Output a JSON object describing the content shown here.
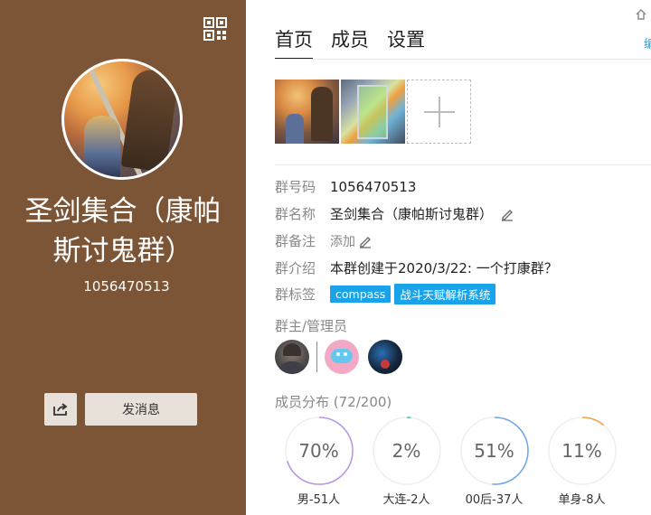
{
  "group": {
    "name": "圣剑集合（康帕斯讨鬼群）",
    "id": "1056470513"
  },
  "actions": {
    "send_message_label": "发消息"
  },
  "tabs": [
    {
      "label": "首页",
      "active": true
    },
    {
      "label": "成员",
      "active": false
    },
    {
      "label": "设置",
      "active": false
    }
  ],
  "top_right_text": "编",
  "info": {
    "id_label": "群号码",
    "id_value": "1056470513",
    "name_label": "群名称",
    "name_value": "圣剑集合（康帕斯讨鬼群）",
    "note_label": "群备注",
    "note_add": "添加",
    "intro_label": "群介绍",
    "intro_value": "本群创建于2020/3/22:  一个打康群？",
    "tags_label": "群标签",
    "tags": [
      "compass",
      "战斗天赋解析系统"
    ]
  },
  "admins_title": "群主/管理员",
  "members": {
    "title": "成员分布",
    "count_text": "(72/200)",
    "stats": [
      {
        "percent": 70,
        "value_text": "70%",
        "label": "男-51人",
        "color": "#b893e6"
      },
      {
        "percent": 2,
        "value_text": "2%",
        "label": "大连-2人",
        "color": "#52c7a0"
      },
      {
        "percent": 51,
        "value_text": "51%",
        "label": "00后-37人",
        "color": "#6ea7e8"
      },
      {
        "percent": 11,
        "value_text": "11%",
        "label": "单身-8人",
        "color": "#f0a24a"
      }
    ]
  },
  "colors": {
    "left_panel": "#7b5535",
    "tag_bg": "#1aa3e8",
    "accent": "#2d9fe0"
  }
}
